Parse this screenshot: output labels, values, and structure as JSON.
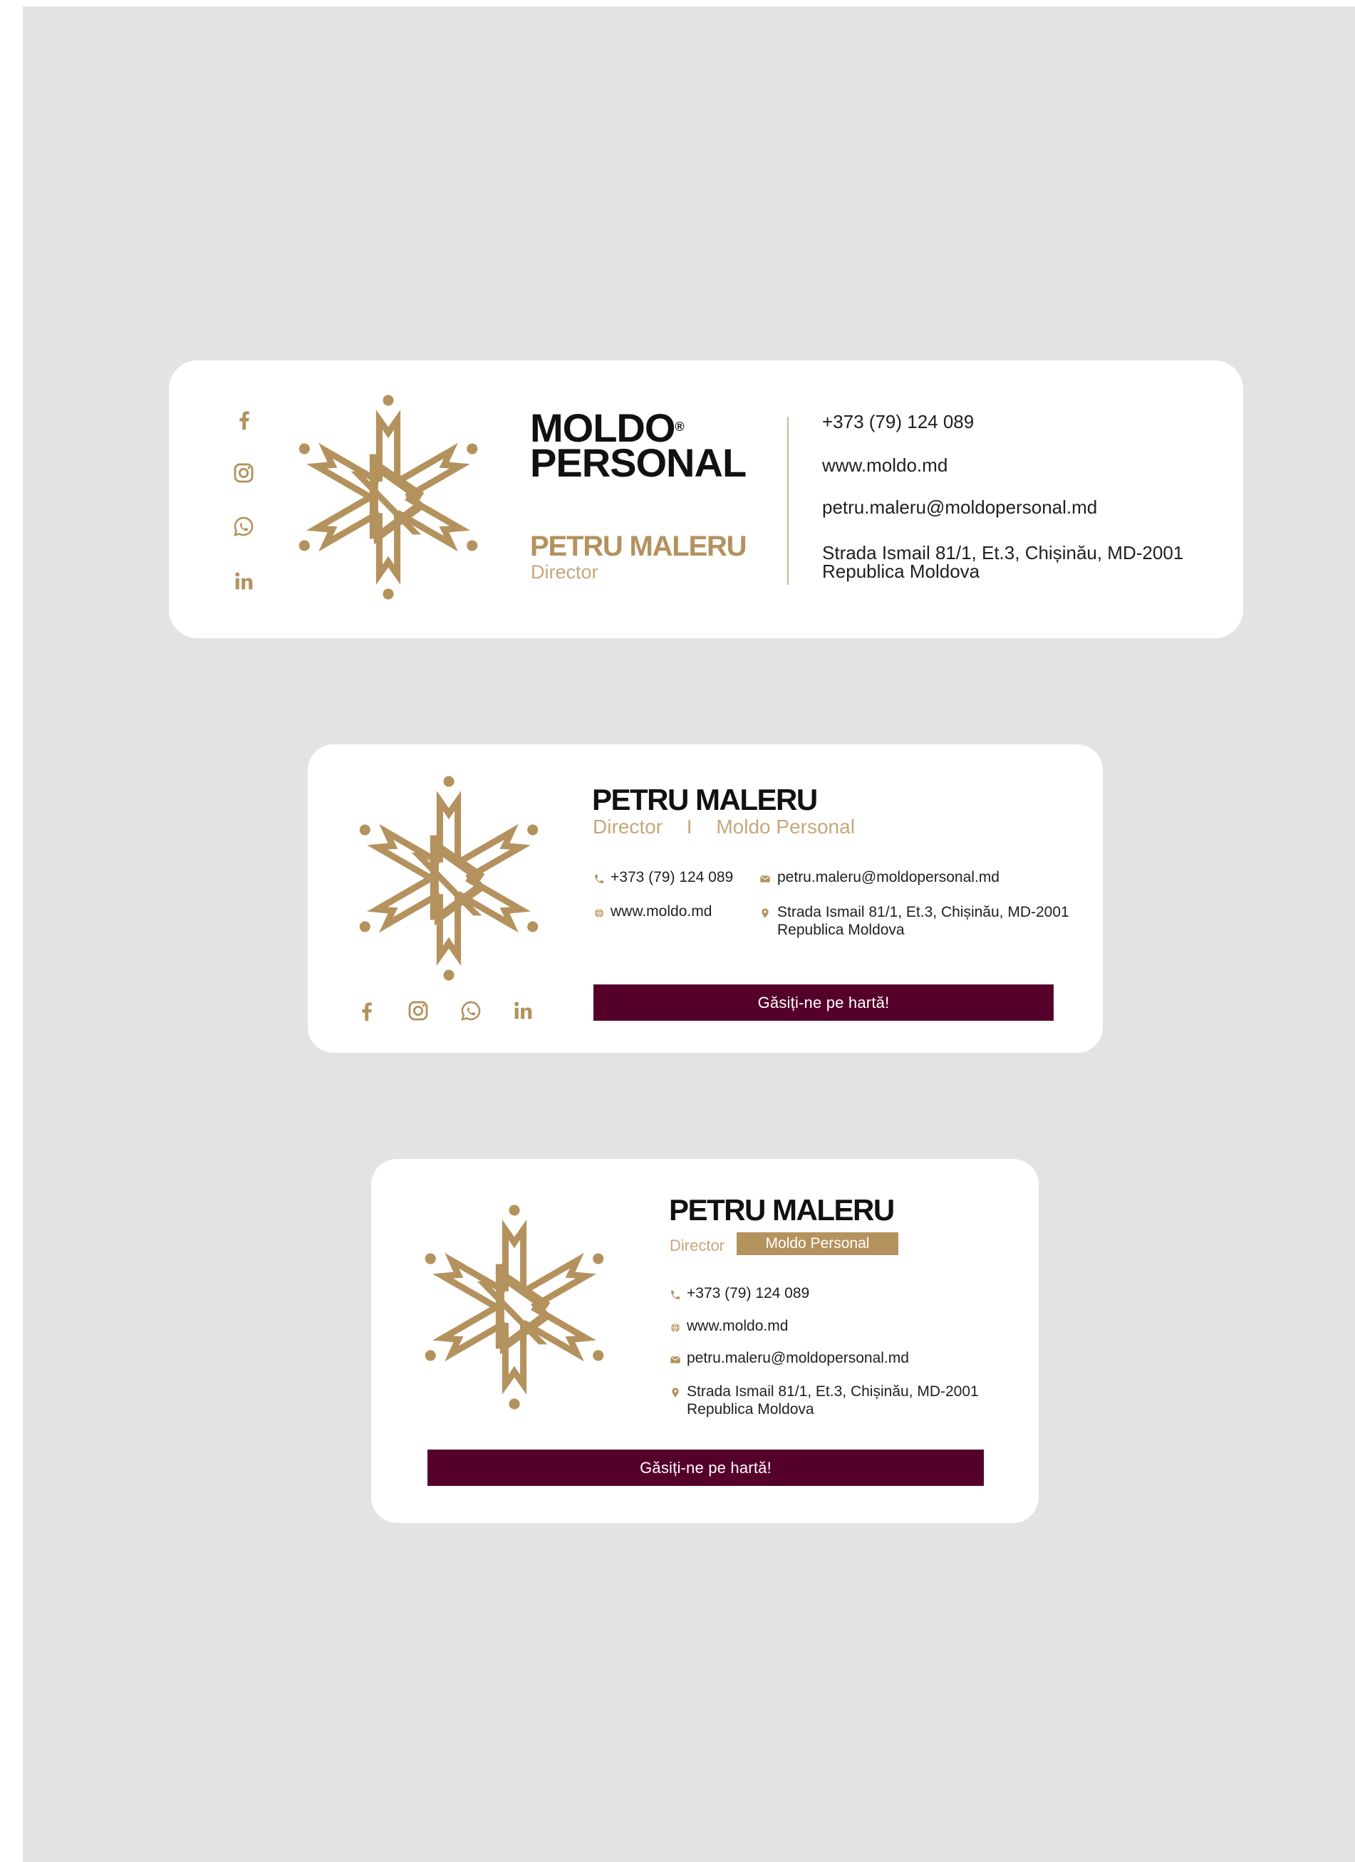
{
  "brand": {
    "line1": "MOLDO",
    "registered": "®",
    "line2": "PERSONAL",
    "gold_color": "#b4925e",
    "button_color": "#55002a",
    "logo_icon": "moldo-personal-snowflake-logo"
  },
  "person": {
    "name": "PETRU MALERU",
    "title": "Director",
    "company": "Moldo Personal",
    "separator": "I"
  },
  "contact": {
    "phone": "+373 (79) 124 089",
    "website": "www.moldo.md",
    "email": "petru.maleru@moldopersonal.md",
    "address_line1": "Strada Ismail 81/1, Et.3, Chișinău, MD-2001",
    "address_line2": "Republica Moldova"
  },
  "social": [
    "facebook-icon",
    "instagram-icon",
    "whatsapp-icon",
    "linkedin-icon"
  ],
  "map_button": "Găsiți-ne pe hartă!"
}
